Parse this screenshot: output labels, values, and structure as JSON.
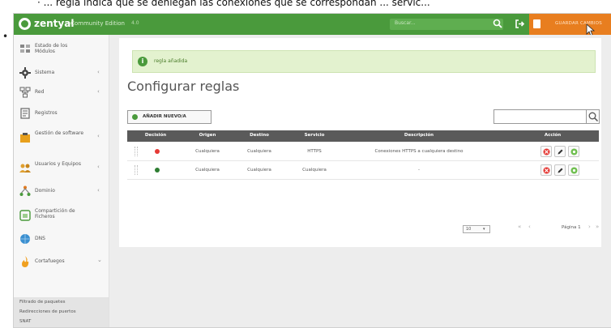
{
  "doc_caption": "· ... regla indica que se deniegan las conexiones que se correspondan ... servic...",
  "app": {
    "brand": "zentyal",
    "edition": "Community Edition",
    "version": "4.0",
    "search_placeholder": "Buscar...",
    "save_label": "GUARDAR CAMBIOS",
    "accent": "#4a9a3c",
    "save_color": "#e87e1f"
  },
  "sidebar": {
    "items": [
      {
        "label": "Estado de los Módulos",
        "icon": "dashboard-icon"
      },
      {
        "label": "Sistema",
        "icon": "gear-icon",
        "arrow": "‹"
      },
      {
        "label": "Red",
        "icon": "network-icon",
        "arrow": "‹"
      },
      {
        "label": "Registros",
        "icon": "logs-icon"
      },
      {
        "label": "Gestión de software",
        "icon": "software-icon",
        "arrow": "‹"
      },
      {
        "label": "Usuarios y Equipos",
        "icon": "users-icon",
        "arrow": "‹"
      },
      {
        "label": "Dominio",
        "icon": "domain-icon",
        "arrow": "‹"
      },
      {
        "label": "Compartición de Ficheros",
        "icon": "file-sharing-icon"
      },
      {
        "label": "DNS",
        "icon": "dns-icon"
      },
      {
        "label": "Cortafuegos",
        "icon": "firewall-icon",
        "arrow": "⌄"
      }
    ],
    "sub_items": [
      "Filtrado de paquetes",
      "Redirecciones de puertos",
      "SNAT"
    ]
  },
  "main": {
    "notice": "regla añadida",
    "title": "Configurar reglas",
    "add_button": "AÑADIR NUEVO/A",
    "filter_placeholder": "",
    "columns": [
      "Decisión",
      "Origen",
      "Destino",
      "Servicio",
      "Descripción",
      "Acción"
    ],
    "rows": [
      {
        "decision": "deny",
        "decision_color": "#e53935",
        "origen": "Cualquiera",
        "destino": "Cualquiera",
        "servicio": "HTTPS",
        "descripcion": "Conexiones HTTPS a cualquiera destino"
      },
      {
        "decision": "accept",
        "decision_color": "#2e7d32",
        "origen": "Cualquiera",
        "destino": "Cualquiera",
        "servicio": "Cualquiera",
        "descripcion": "-"
      }
    ],
    "page_size": "10",
    "page_label": "Página 1"
  }
}
